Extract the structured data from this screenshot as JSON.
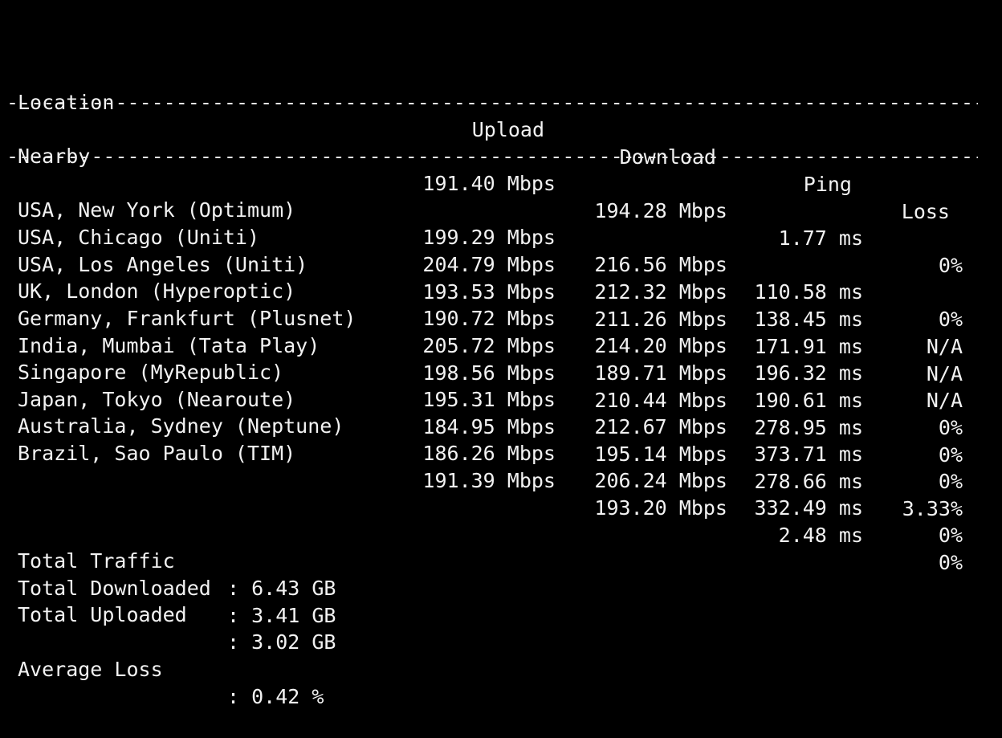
{
  "headers": {
    "location": "Location",
    "upload": "Upload",
    "download": "Download",
    "ping": "Ping",
    "loss": "Loss"
  },
  "separator": "----------------------------------------------------------------------------------------------------",
  "nearby": {
    "location": "Nearby",
    "upload": "191.40 Mbps",
    "download": "194.28 Mbps",
    "ping": "1.77 ms",
    "loss": "0%"
  },
  "rows": [
    {
      "location": "USA, New York (Optimum)",
      "upload": "199.29 Mbps",
      "download": "216.56 Mbps",
      "ping": "110.58 ms",
      "loss": "0%"
    },
    {
      "location": "USA, Chicago (Uniti)",
      "upload": "204.79 Mbps",
      "download": "212.32 Mbps",
      "ping": "138.45 ms",
      "loss": "N/A"
    },
    {
      "location": "USA, Los Angeles (Uniti)",
      "upload": "193.53 Mbps",
      "download": "211.26 Mbps",
      "ping": "171.91 ms",
      "loss": "N/A"
    },
    {
      "location": "UK, London (Hyperoptic)",
      "upload": "190.72 Mbps",
      "download": "214.20 Mbps",
      "ping": "196.32 ms",
      "loss": "N/A"
    },
    {
      "location": "Germany, Frankfurt (Plusnet)",
      "upload": "205.72 Mbps",
      "download": "189.71 Mbps",
      "ping": "190.61 ms",
      "loss": "0%"
    },
    {
      "location": "India, Mumbai (Tata Play)",
      "upload": "198.56 Mbps",
      "download": "210.44 Mbps",
      "ping": "278.95 ms",
      "loss": "0%"
    },
    {
      "location": "Singapore (MyRepublic)",
      "upload": "195.31 Mbps",
      "download": "212.67 Mbps",
      "ping": "373.71 ms",
      "loss": "0%"
    },
    {
      "location": "Japan, Tokyo (Nearoute)",
      "upload": "184.95 Mbps",
      "download": "195.14 Mbps",
      "ping": "278.66 ms",
      "loss": "3.33%"
    },
    {
      "location": "Australia, Sydney (Neptune)",
      "upload": "186.26 Mbps",
      "download": "206.24 Mbps",
      "ping": "332.49 ms",
      "loss": "0%"
    },
    {
      "location": "Brazil, Sao Paulo (TIM)",
      "upload": "191.39 Mbps",
      "download": "193.20 Mbps",
      "ping": "2.48 ms",
      "loss": "0%"
    }
  ],
  "summary": {
    "total_traffic": {
      "label": "Total Traffic",
      "value": ": 6.43 GB"
    },
    "total_downloaded": {
      "label": "Total Downloaded",
      "value": ": 3.41 GB"
    },
    "total_uploaded": {
      "label": "Total Uploaded",
      "value": ": 3.02 GB"
    },
    "average_loss": {
      "label": "Average Loss",
      "value": ": 0.42 %"
    }
  },
  "colors": {
    "background": "#000000",
    "text": "#f2f2f2"
  }
}
